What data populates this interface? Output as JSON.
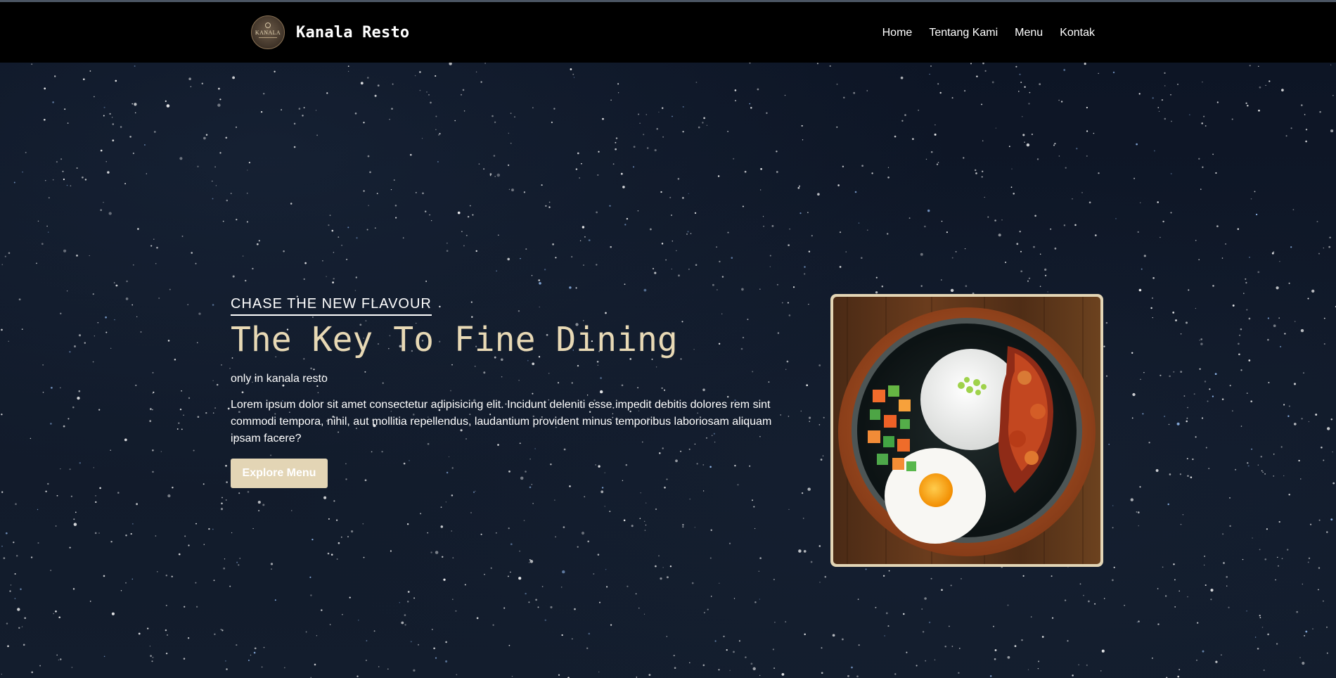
{
  "navbar": {
    "logo_text": "KANALA",
    "brand_name": "Kanala Resto",
    "links": [
      "Home",
      "Tentang Kami",
      "Menu",
      "Kontak"
    ]
  },
  "hero": {
    "eyebrow": "CHASE THE NEW FLAVOUR",
    "headline": "The Key To Fine Dining",
    "subline": "only in kanala resto",
    "paragraph": "Lorem ipsum dolor sit amet consectetur adipisicing elit. Incidunt deleniti esse impedit debitis dolores rem sint commodi tempora, nihil, aut mollitia repellendus, laudantium provident minus temporibus laboriosam aliquam ipsam facere?",
    "cta_label": "Explore Menu"
  },
  "colors": {
    "navbar_bg": "#000000",
    "accent": "#e3d5b5",
    "headline": "#e8d9b5",
    "background": "#111a2a"
  },
  "icons": {
    "logo": "kanala-logo-icon",
    "food_image": "sizzling-plate-photo"
  }
}
